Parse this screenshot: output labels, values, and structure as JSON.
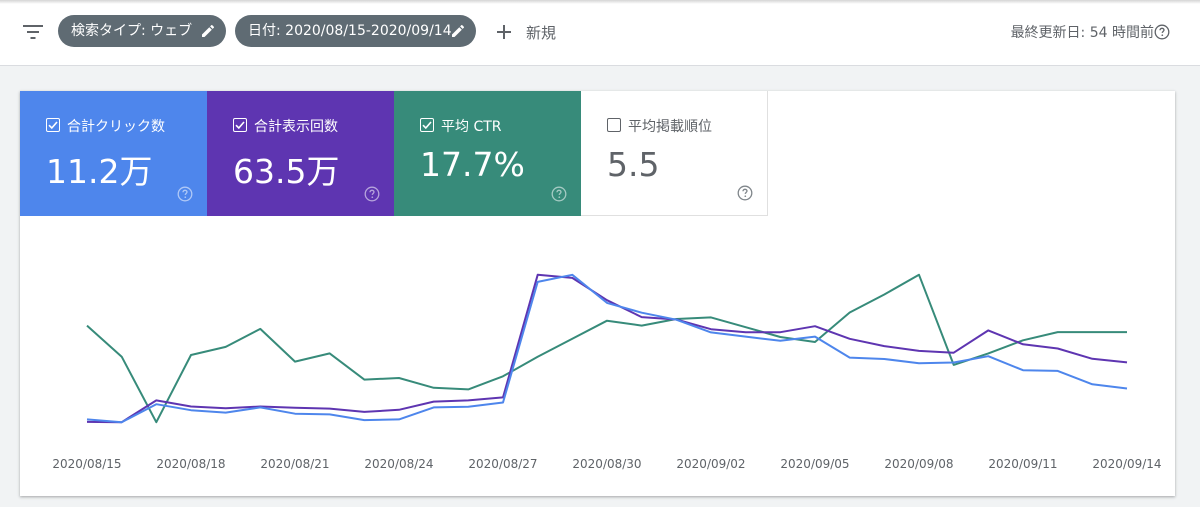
{
  "toolbar": {
    "filter_icon": "filter-list-icon",
    "search_type_chip": "検索タイプ: ウェブ",
    "date_chip": "日付: 2020/08/15-2020/09/14",
    "new_label": "新規",
    "last_updated": "最終更新日: 54 時間前",
    "chip_color": "#5f6b73"
  },
  "metrics": [
    {
      "label": "合計クリック数",
      "value": "11.2万",
      "checked": true,
      "color": "#4e86ec"
    },
    {
      "label": "合計表示回数",
      "value": "63.5万",
      "checked": true,
      "color": "#5e35b1"
    },
    {
      "label": "平均 CTR",
      "value": "17.7%",
      "checked": true,
      "color": "#378b7a"
    },
    {
      "label": "平均掲載順位",
      "value": "5.5",
      "checked": false,
      "color": "#ffffff"
    }
  ],
  "chart_data": {
    "type": "line",
    "x": [
      "2020/08/15",
      "2020/08/16",
      "2020/08/17",
      "2020/08/18",
      "2020/08/19",
      "2020/08/20",
      "2020/08/21",
      "2020/08/22",
      "2020/08/23",
      "2020/08/24",
      "2020/08/25",
      "2020/08/26",
      "2020/08/27",
      "2020/08/28",
      "2020/08/29",
      "2020/08/30",
      "2020/08/31",
      "2020/09/01",
      "2020/09/02",
      "2020/09/03",
      "2020/09/04",
      "2020/09/05",
      "2020/09/06",
      "2020/09/07",
      "2020/09/08",
      "2020/09/09",
      "2020/09/10",
      "2020/09/11",
      "2020/09/12",
      "2020/09/13",
      "2020/09/14"
    ],
    "xticks": [
      "2020/08/15",
      "2020/08/18",
      "2020/08/21",
      "2020/08/24",
      "2020/08/27",
      "2020/08/30",
      "2020/09/02",
      "2020/09/05",
      "2020/09/08",
      "2020/09/11",
      "2020/09/14"
    ],
    "series": [
      {
        "color": "#4e86ec",
        "values": [
          1100,
          900,
          2180,
          1750,
          1580,
          1950,
          1500,
          1450,
          1050,
          1100,
          1950,
          2000,
          2300,
          10900,
          11400,
          9400,
          8700,
          8200,
          7300,
          7000,
          6700,
          7000,
          5500,
          5400,
          5100,
          5150,
          5600,
          4600,
          4550,
          3600,
          3300
        ]
      },
      {
        "color": "#5e35b1",
        "values": [
          3150,
          3100,
          6700,
          5700,
          5400,
          5700,
          5500,
          5350,
          4800,
          5150,
          6500,
          6700,
          7200,
          27500,
          27000,
          23300,
          20500,
          20100,
          18500,
          18000,
          18000,
          19000,
          16900,
          15700,
          14900,
          14600,
          18300,
          16000,
          15300,
          13600,
          13000
        ]
      },
      {
        "color": "#378b7a",
        "values": [
          25.2,
          23.3,
          19.3,
          23.4,
          23.9,
          25.0,
          23.0,
          23.5,
          21.9,
          22.0,
          21.4,
          21.3,
          22.1,
          23.3,
          24.4,
          25.5,
          25.2,
          25.6,
          25.7,
          25.1,
          24.5,
          24.2,
          26.0,
          27.1,
          28.3,
          22.8,
          23.5,
          24.3,
          24.8,
          24.8,
          24.8
        ]
      }
    ]
  }
}
